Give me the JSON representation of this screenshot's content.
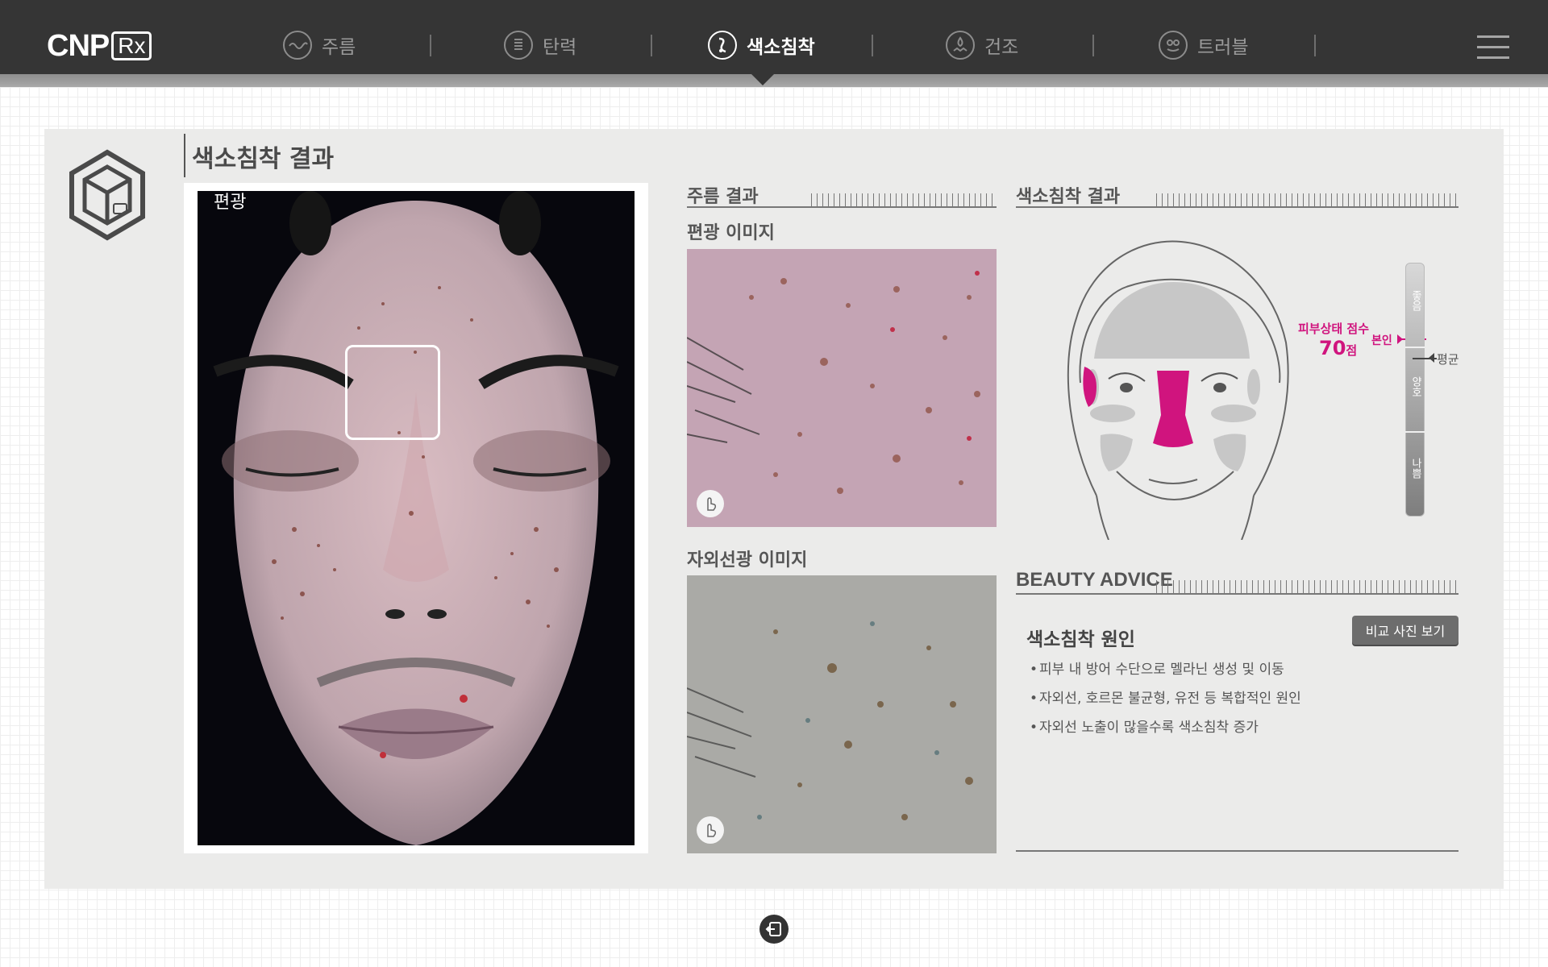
{
  "header": {
    "logo_text": "CNP",
    "logo_badge": "Rx",
    "tabs": [
      {
        "label": "주름",
        "icon": "wrinkle-icon",
        "active": false
      },
      {
        "label": "탄력",
        "icon": "elasticity-icon",
        "active": false
      },
      {
        "label": "색소침착",
        "icon": "pigmentation-icon",
        "active": true
      },
      {
        "label": "건조",
        "icon": "dryness-icon",
        "active": false
      },
      {
        "label": "트러블",
        "icon": "trouble-icon",
        "active": false
      }
    ],
    "menu_icon": "hamburger-menu-icon"
  },
  "main": {
    "title": "색소침착 결과",
    "photo_label": "편광"
  },
  "images": {
    "section_title": "주름 결과",
    "polarized_title": "편광 이미지",
    "uv_title": "자외선광 이미지",
    "hand_icon": "hand-touch-icon"
  },
  "result": {
    "title": "색소침착 결과",
    "score_label": "피부상태 점수",
    "score_value": "70",
    "score_unit": "점",
    "self_label": "본인",
    "average_label": "평균",
    "scale": [
      "좋음",
      "양호",
      "나쁨"
    ]
  },
  "advice": {
    "section_title": "BEAUTY ADVICE",
    "cause_title": "색소침착 원인",
    "compare_button": "비교 사진 보기",
    "items": [
      "피부 내 방어 수단으로 멜라닌 생성 및 이동",
      "자외선, 호르몬 불균형, 유전 등 복합적인 원인",
      "자외선 노출이 많을수록 색소침착 증가"
    ]
  },
  "footer": {
    "exit_icon": "exit-icon"
  },
  "colors": {
    "topbar": "#353535",
    "accent": "#d0147e",
    "panel": "#ebebea"
  }
}
